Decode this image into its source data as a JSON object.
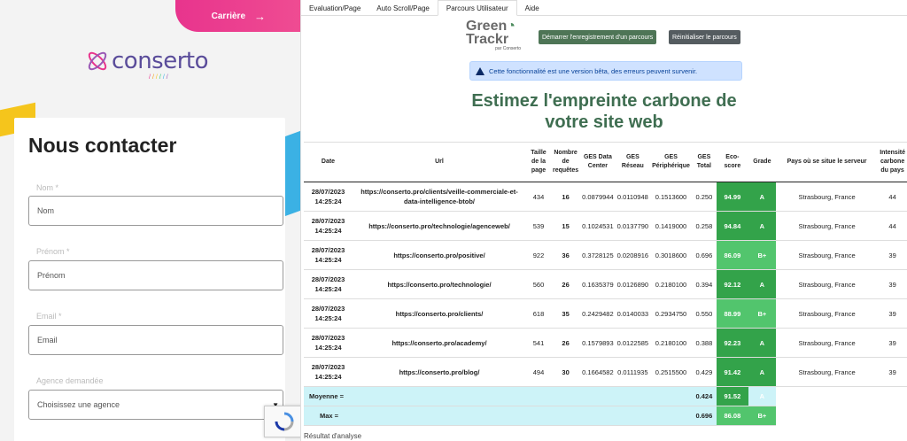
{
  "left": {
    "top_link": "Carrière",
    "logo_text": "conserto",
    "heading": "Nous contacter",
    "fields": [
      {
        "label": "Nom *",
        "placeholder": "Nom"
      },
      {
        "label": "Prénom *",
        "placeholder": "Prénom"
      },
      {
        "label": "Email *",
        "placeholder": "Email"
      },
      {
        "label": "Agence demandée",
        "placeholder": "Choisissez une agence"
      }
    ]
  },
  "right": {
    "tabs": [
      "Evaluation/Page",
      "Auto Scroll/Page",
      "Parcours Utilisateur",
      "Aide"
    ],
    "active_tab": "Parcours Utilisateur",
    "logo": {
      "line1": "Green",
      "line2": "Trackr",
      "line3": "par Conserto"
    },
    "buttons": {
      "start": "Démarrer l'enregistrement d'un parcours",
      "reset": "Réinitialiser le parcours"
    },
    "beta_notice": "Cette fonctionnalité est une version bêta, des erreurs peuvent survenir.",
    "headline": "Estimez l'empreinte carbone de votre site web",
    "columns": [
      "Date",
      "Url",
      "Taille de la page",
      "Nombre de requêtes",
      "GES Data Center",
      "GES Réseau",
      "GES Périphérique",
      "GES Total",
      "Eco-score",
      "Grade",
      "Pays où se situe le serveur",
      "Intensité carbone du pays"
    ],
    "rows": [
      {
        "date": "28/07/2023 14:25:24",
        "url": "https://conserto.pro/clients/veille-commerciale-et-data-intelligence-btob/",
        "size": "434",
        "requests": "16",
        "dc": "0.0879944",
        "net": "0.0110948",
        "dev": "0.1513600",
        "total": "0.250",
        "eco": "94.99",
        "grade": "A",
        "country": "Strasbourg, France",
        "intensity": "44"
      },
      {
        "date": "28/07/2023 14:25:24",
        "url": "https://conserto.pro/technologie/agenceweb/",
        "size": "539",
        "requests": "15",
        "dc": "0.1024531",
        "net": "0.0137790",
        "dev": "0.1419000",
        "total": "0.258",
        "eco": "94.84",
        "grade": "A",
        "country": "Strasbourg, France",
        "intensity": "44"
      },
      {
        "date": "28/07/2023 14:25:24",
        "url": "https://conserto.pro/positive/",
        "size": "922",
        "requests": "36",
        "dc": "0.3728125",
        "net": "0.0208916",
        "dev": "0.3018600",
        "total": "0.696",
        "eco": "86.09",
        "grade": "B+",
        "country": "Strasbourg, France",
        "intensity": "39"
      },
      {
        "date": "28/07/2023 14:25:24",
        "url": "https://conserto.pro/technologie/",
        "size": "560",
        "requests": "26",
        "dc": "0.1635379",
        "net": "0.0126890",
        "dev": "0.2180100",
        "total": "0.394",
        "eco": "92.12",
        "grade": "A",
        "country": "Strasbourg, France",
        "intensity": "39"
      },
      {
        "date": "28/07/2023 14:25:24",
        "url": "https://conserto.pro/clients/",
        "size": "618",
        "requests": "35",
        "dc": "0.2429482",
        "net": "0.0140033",
        "dev": "0.2934750",
        "total": "0.550",
        "eco": "88.99",
        "grade": "B+",
        "country": "Strasbourg, France",
        "intensity": "39"
      },
      {
        "date": "28/07/2023 14:25:24",
        "url": "https://conserto.pro/academy/",
        "size": "541",
        "requests": "26",
        "dc": "0.1579893",
        "net": "0.0122585",
        "dev": "0.2180100",
        "total": "0.388",
        "eco": "92.23",
        "grade": "A",
        "country": "Strasbourg, France",
        "intensity": "39"
      },
      {
        "date": "28/07/2023 14:25:24",
        "url": "https://conserto.pro/blog/",
        "size": "494",
        "requests": "30",
        "dc": "0.1664582",
        "net": "0.0111935",
        "dev": "0.2515500",
        "total": "0.429",
        "eco": "91.42",
        "grade": "A",
        "country": "Strasbourg, France",
        "intensity": "39"
      }
    ],
    "summary": {
      "avg_label": "Moyenne =",
      "avg_total": "0.424",
      "avg_eco": "91.52",
      "avg_grade": "A",
      "max_label": "Max =",
      "max_total": "0.696",
      "max_eco": "86.08",
      "max_grade": "B+"
    },
    "footer": "Résultat d'analyse"
  },
  "colors": {
    "brand_green": "#4e7556",
    "eco_green": "#33a34a",
    "eco_light": "#52c56d",
    "pink": "#e8348d",
    "summary_bg": "#cdf3f8"
  }
}
